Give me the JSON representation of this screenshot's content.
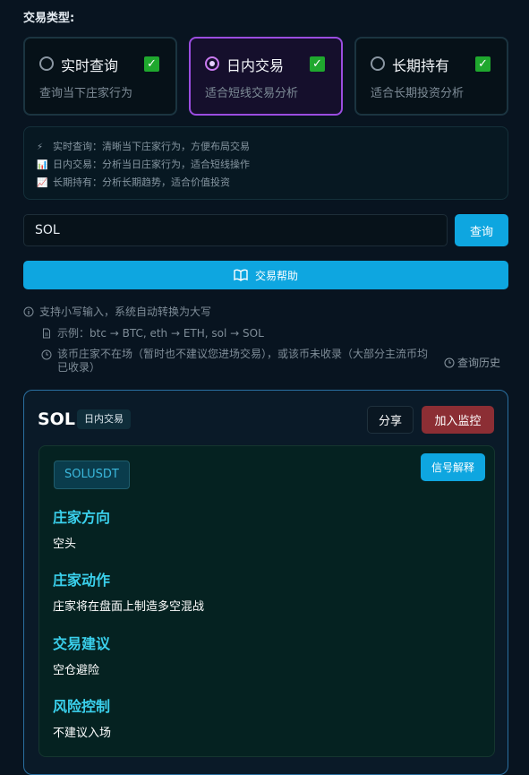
{
  "section_label": "交易类型:",
  "trade_types": [
    {
      "title": "实时查询",
      "desc": "查询当下庄家行为",
      "selected": false,
      "checked": true
    },
    {
      "title": "日内交易",
      "desc": "适合短线交易分析",
      "selected": true,
      "checked": true
    },
    {
      "title": "长期持有",
      "desc": "适合长期投资分析",
      "selected": false,
      "checked": true
    }
  ],
  "info": [
    {
      "icon": "⚡",
      "text": "实时查询：清晰当下庄家行为，方便布局交易"
    },
    {
      "icon": "📊",
      "text": "日内交易：分析当日庄家行为，适合短线操作"
    },
    {
      "icon": "📈",
      "text": "长期持有：分析长期趋势，适合价值投资"
    }
  ],
  "search": {
    "value": "SOL",
    "button": "查询"
  },
  "help_button": "交易帮助",
  "hints": {
    "lowercase": "支持小写输入，系统自动转换为大写",
    "example": "示例：btc → BTC, eth → ETH, sol → SOL",
    "warning_line1": "该币庄家不在场（暂时也不建议您进场交易），或该币未收录（大部分主流币均",
    "warning_line2": "已收录）",
    "history": "查询历史"
  },
  "result": {
    "coin": "SOL",
    "tag": "日内交易",
    "share": "分享",
    "monitor": "加入监控",
    "pair": "SOLUSDT",
    "explain": "信号解释",
    "sections": [
      {
        "title": "庄家方向",
        "body": "空头"
      },
      {
        "title": "庄家动作",
        "body": "庄家将在盘面上制造多空混战"
      },
      {
        "title": "交易建议",
        "body": "空仓避险"
      },
      {
        "title": "风险控制",
        "body": "不建议入场"
      }
    ]
  },
  "colors": {
    "accent": "#0ea6e0",
    "selected_border": "#9b4de0",
    "monitor": "#8c2e34",
    "section_title": "#3ad0ec"
  }
}
